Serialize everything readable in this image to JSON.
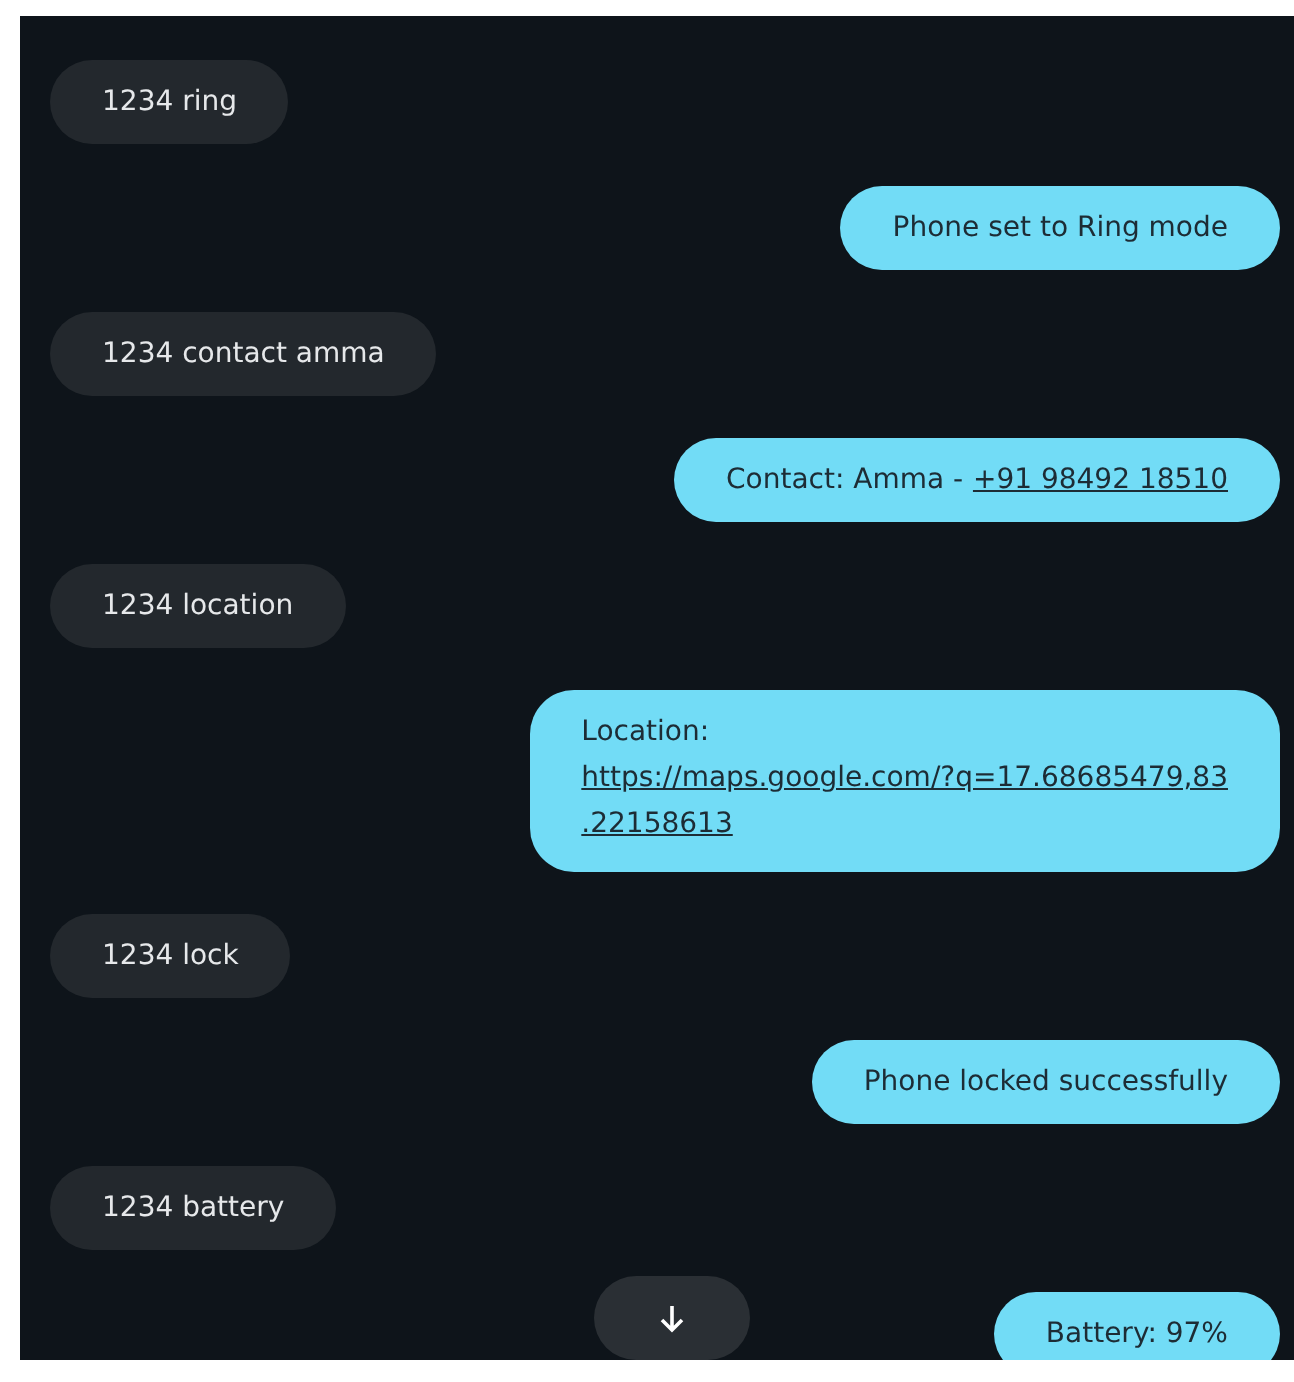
{
  "messages": [
    {
      "kind": "received",
      "parts": [
        {
          "kind": "text",
          "text": "1234 ring"
        }
      ]
    },
    {
      "kind": "sent",
      "parts": [
        {
          "kind": "text",
          "text": "Phone set to Ring mode"
        }
      ]
    },
    {
      "kind": "received",
      "parts": [
        {
          "kind": "text",
          "text": "1234 contact amma"
        }
      ]
    },
    {
      "kind": "sent",
      "parts": [
        {
          "kind": "text",
          "text": "Contact: Amma -"
        },
        {
          "kind": "link",
          "text": "+91 98492 18510"
        }
      ]
    },
    {
      "kind": "received",
      "parts": [
        {
          "kind": "text",
          "text": "1234 location"
        }
      ]
    },
    {
      "kind": "sent",
      "parts": [
        {
          "kind": "text",
          "text": "Location:"
        },
        {
          "kind": "link",
          "text": "https://maps.google.com/?q=17.68685479,83"
        },
        {
          "kind": "link",
          "text": ".22158613"
        }
      ]
    },
    {
      "kind": "received",
      "parts": [
        {
          "kind": "text",
          "text": "1234 lock"
        }
      ]
    },
    {
      "kind": "sent",
      "parts": [
        {
          "kind": "text",
          "text": "Phone locked successfully"
        }
      ]
    },
    {
      "kind": "received",
      "parts": [
        {
          "kind": "text",
          "text": "1234 battery"
        }
      ]
    },
    {
      "kind": "sent",
      "parts": [
        {
          "kind": "text",
          "text": "Battery: 97%"
        }
      ]
    }
  ]
}
